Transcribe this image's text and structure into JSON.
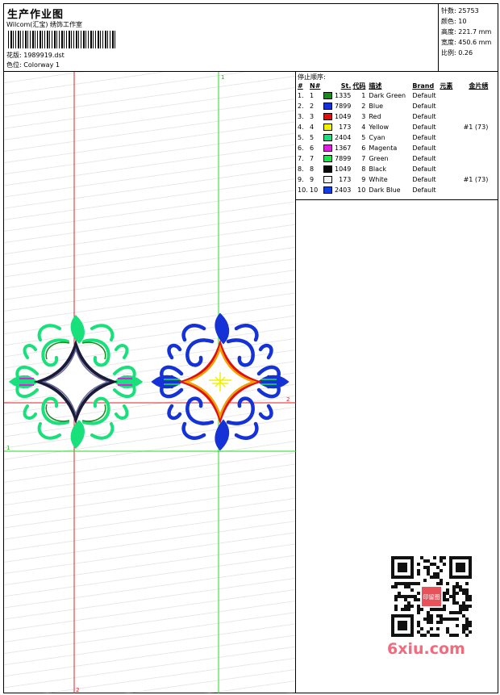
{
  "header": {
    "title": "生产作业图",
    "subtitle": "Wilcom(汇宝) 绣饰工作室",
    "design_label": "花版:",
    "design_value": "1989919.dst",
    "colorway_label": "色位:",
    "colorway_value": "Colorway 1"
  },
  "stats": {
    "stitches": "针数: 25753",
    "colors": "颜色: 10",
    "height": "高度: 221.7 mm",
    "width": "宽度: 450.6 mm",
    "scale": "比例: 0.26"
  },
  "canvas": {
    "marker_top": "1",
    "marker_left": "1",
    "marker_right": "2",
    "marker_bottom": "2"
  },
  "thread_table": {
    "title": "停止顺序:",
    "headers": [
      "#",
      "N#",
      "St.",
      "代码",
      "描述",
      "Brand",
      "元素",
      "金片绣"
    ],
    "rows": [
      {
        "idx": "1.",
        "n": "1",
        "color": "#1a8a1a",
        "st": "1335",
        "code": "1",
        "desc": "Dark Green",
        "brand": "Default",
        "elem": "",
        "seq": ""
      },
      {
        "idx": "2.",
        "n": "2",
        "color": "#1432d6",
        "st": "7899",
        "code": "2",
        "desc": "Blue",
        "brand": "Default",
        "elem": "",
        "seq": ""
      },
      {
        "idx": "3.",
        "n": "3",
        "color": "#e01010",
        "st": "1049",
        "code": "3",
        "desc": "Red",
        "brand": "Default",
        "elem": "",
        "seq": ""
      },
      {
        "idx": "4.",
        "n": "4",
        "color": "#f2f200",
        "st": "173",
        "code": "4",
        "desc": "Yellow",
        "brand": "Default",
        "elem": "",
        "seq": "#1 (73)"
      },
      {
        "idx": "5.",
        "n": "5",
        "color": "#18e07a",
        "st": "2404",
        "code": "5",
        "desc": "Cyan",
        "brand": "Default",
        "elem": "",
        "seq": ""
      },
      {
        "idx": "6.",
        "n": "6",
        "color": "#e020e0",
        "st": "1367",
        "code": "6",
        "desc": "Magenta",
        "brand": "Default",
        "elem": "",
        "seq": ""
      },
      {
        "idx": "7.",
        "n": "7",
        "color": "#18e84a",
        "st": "7899",
        "code": "7",
        "desc": "Green",
        "brand": "Default",
        "elem": "",
        "seq": ""
      },
      {
        "idx": "8.",
        "n": "8",
        "color": "#0a0a0a",
        "st": "1049",
        "code": "8",
        "desc": "Black",
        "brand": "Default",
        "elem": "",
        "seq": ""
      },
      {
        "idx": "9.",
        "n": "9",
        "color": "#f4f4f4",
        "st": "173",
        "code": "9",
        "desc": "White",
        "brand": "Default",
        "elem": "",
        "seq": "#1 (73)"
      },
      {
        "idx": "10.",
        "n": "10",
        "color": "#1040e0",
        "st": "2403",
        "code": "10",
        "desc": "Dark Blue",
        "brand": "Default",
        "elem": "",
        "seq": ""
      }
    ]
  },
  "watermark": {
    "text": "6xiu.com",
    "seal_text": "印留图"
  },
  "colors": {
    "guide_red": "#e02020",
    "guide_green": "#22dd22",
    "watermark_pink": "#f26a7c"
  }
}
